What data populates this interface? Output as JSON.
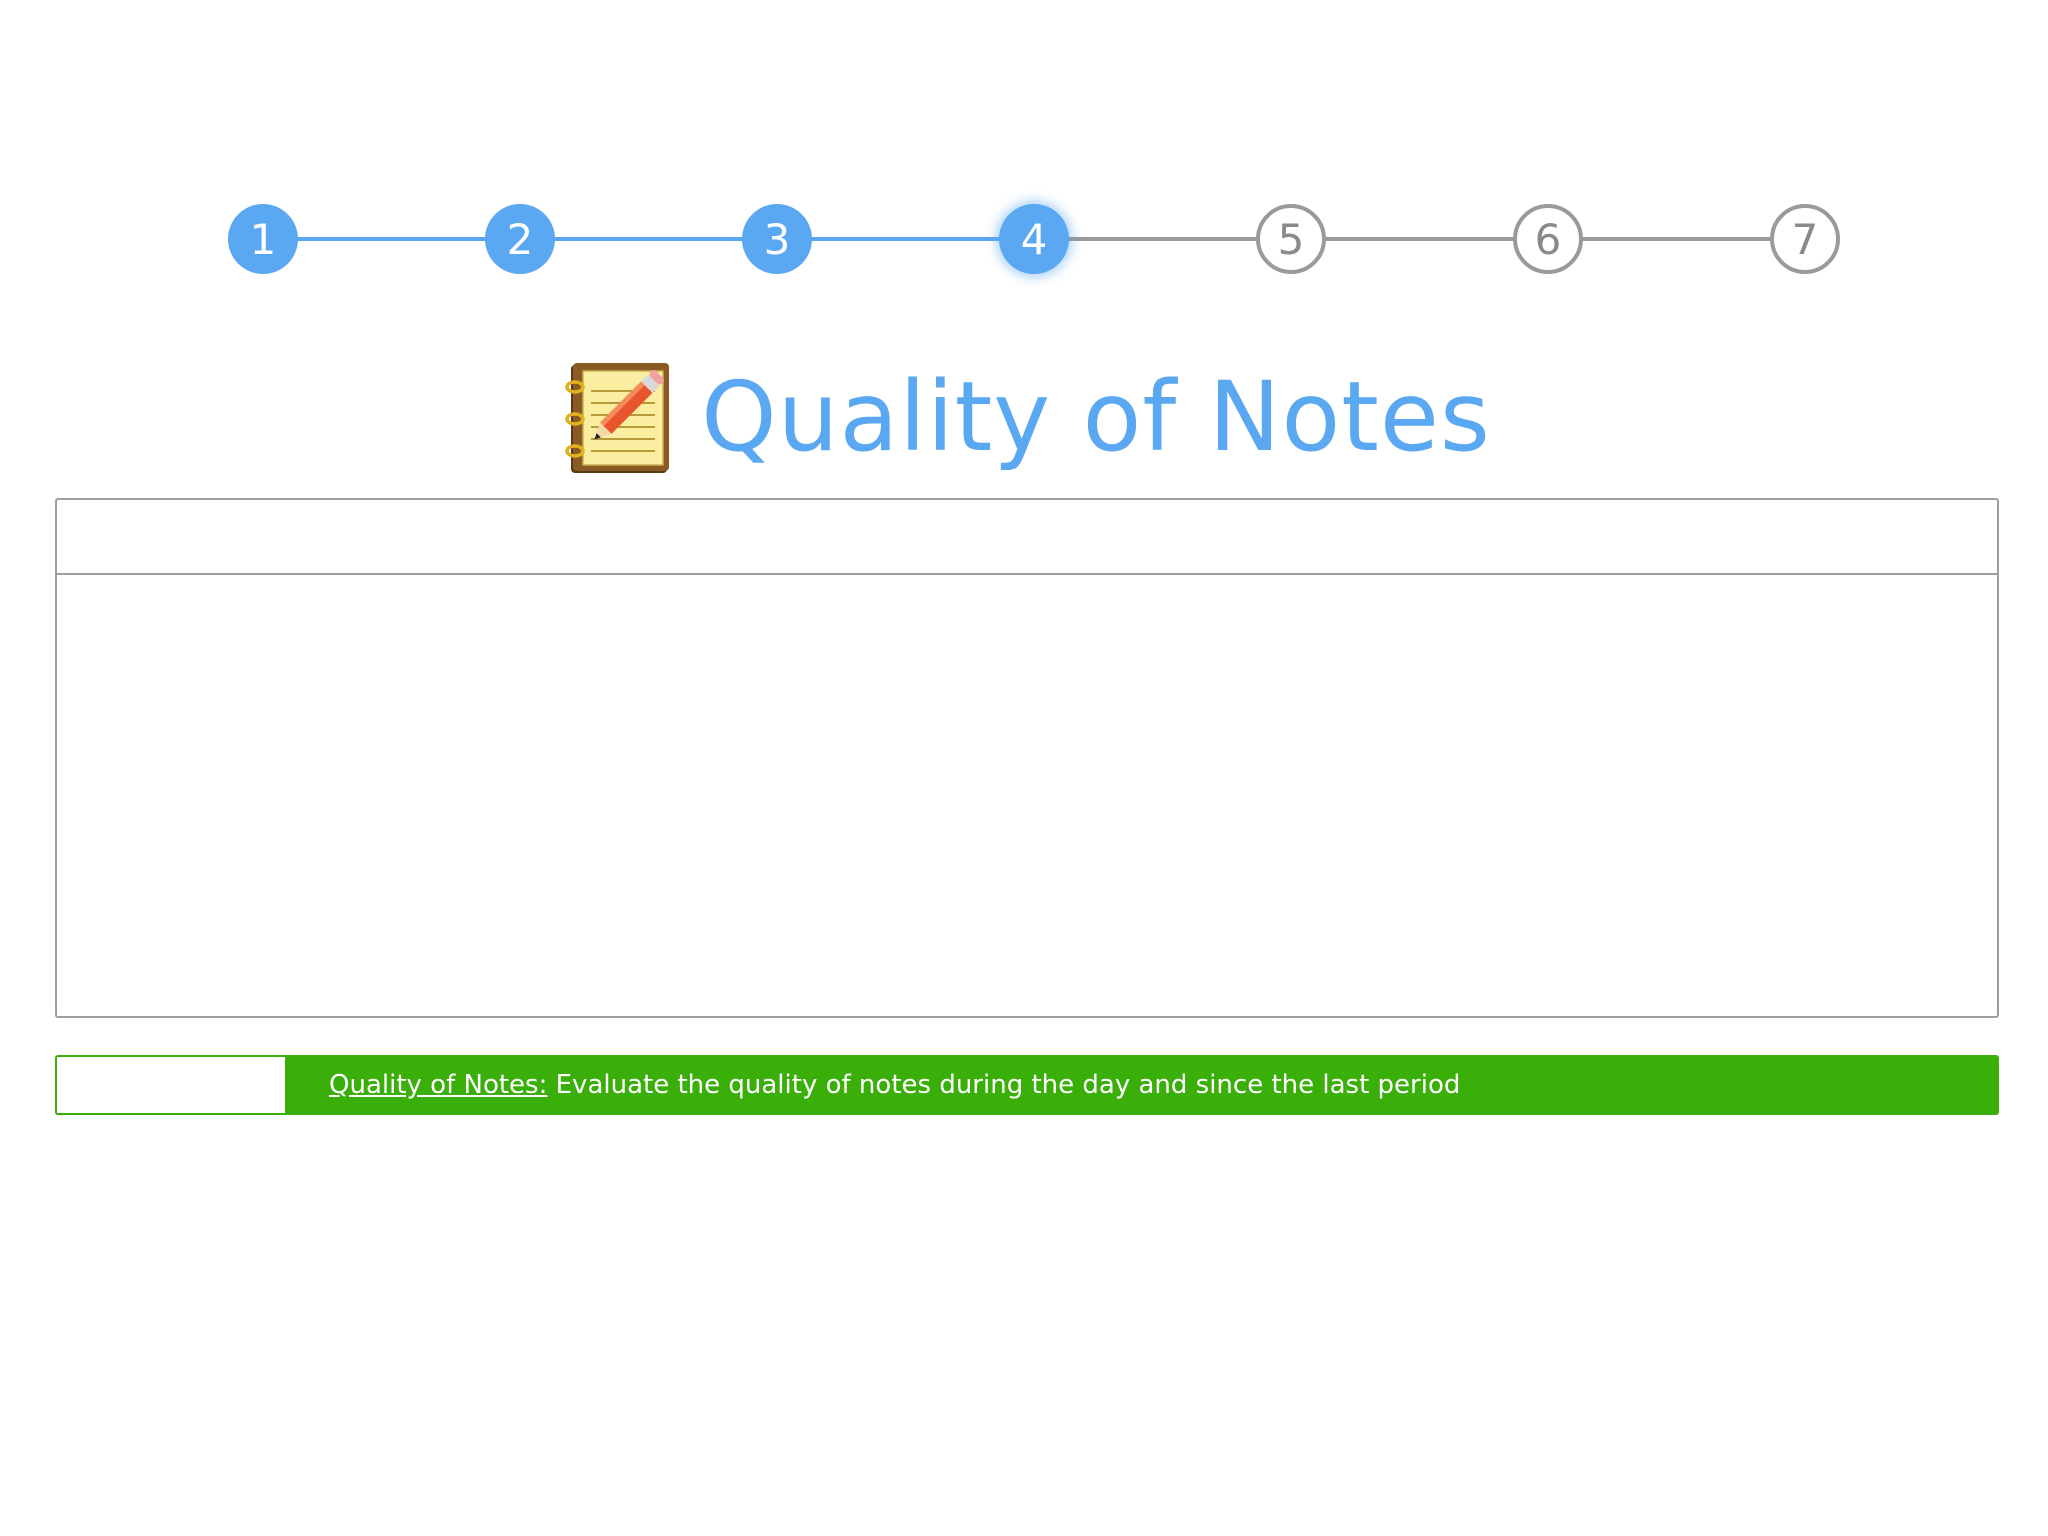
{
  "stepper": {
    "steps": [
      {
        "label": "1",
        "state": "done"
      },
      {
        "label": "2",
        "state": "done"
      },
      {
        "label": "3",
        "state": "done"
      },
      {
        "label": "4",
        "state": "current"
      },
      {
        "label": "5",
        "state": "todo"
      },
      {
        "label": "6",
        "state": "todo"
      },
      {
        "label": "7",
        "state": "todo"
      }
    ],
    "colors": {
      "active": "#5aa7f2",
      "inactive": "#9a9a9a"
    }
  },
  "title": {
    "icon": "notebook-pencil-icon",
    "text": "Quality of Notes",
    "color": "#5aa7f2"
  },
  "panel": {
    "header_text": "",
    "body_text": ""
  },
  "infobar": {
    "input_value": "",
    "link_text": "Quality of Notes:",
    "description": " Evaluate the quality of notes during the day and since the last period",
    "color": "#3aaf0a"
  }
}
